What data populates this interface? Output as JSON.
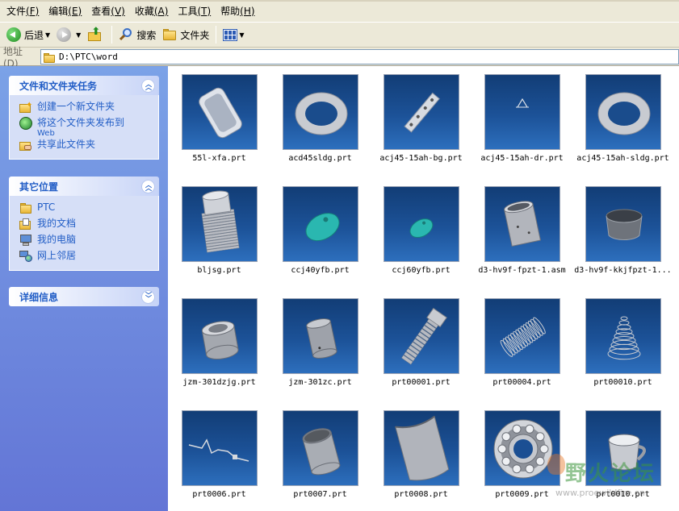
{
  "menu": {
    "items": [
      {
        "label": "文件",
        "key": "(F)"
      },
      {
        "label": "编辑",
        "key": "(E)"
      },
      {
        "label": "查看",
        "key": "(V)"
      },
      {
        "label": "收藏",
        "key": "(A)"
      },
      {
        "label": "工具",
        "key": "(T)"
      },
      {
        "label": "帮助",
        "key": "(H)"
      }
    ]
  },
  "toolbar": {
    "back_label": "后退",
    "search_label": "搜索",
    "folders_label": "文件夹",
    "icons": [
      "back-arrow-icon",
      "forward-arrow-icon",
      "up-folder-icon",
      "search-icon",
      "folder-icon",
      "views-icon"
    ]
  },
  "address": {
    "label": "地址",
    "key": "(D)",
    "path": "D:\\PTC\\word"
  },
  "taskpane": {
    "file_tasks": {
      "title": "文件和文件夹任务",
      "items": [
        {
          "label": "创建一个新文件夹",
          "sub": ""
        },
        {
          "label": "将这个文件夹发布到",
          "sub": "Web"
        },
        {
          "label": "共享此文件夹",
          "sub": ""
        }
      ]
    },
    "other_places": {
      "title": "其它位置",
      "items": [
        {
          "label": "PTC"
        },
        {
          "label": "我的文档"
        },
        {
          "label": "我的电脑"
        },
        {
          "label": "网上邻居"
        }
      ]
    },
    "details": {
      "title": "详细信息"
    }
  },
  "files": [
    {
      "name": "55l-xfa.prt",
      "shape": "tub"
    },
    {
      "name": "acd45sldg.prt",
      "shape": "ring"
    },
    {
      "name": "acj45-15ah-bg.prt",
      "shape": "plate"
    },
    {
      "name": "acj45-15ah-dr.prt",
      "shape": "triangle"
    },
    {
      "name": "acj45-15ah-sldg.prt",
      "shape": "ring"
    },
    {
      "name": "bljsg.prt",
      "shape": "threaded-cylinder"
    },
    {
      "name": "ccj40yfb.prt",
      "shape": "oval-cyan"
    },
    {
      "name": "ccj60yfb.prt",
      "shape": "oval-cyan-small"
    },
    {
      "name": "d3-hv9f-fpzt-1.asm",
      "shape": "cylinder"
    },
    {
      "name": "d3-hv9f-kkjfpzt-1...",
      "shape": "band"
    },
    {
      "name": "jzm-301dzjg.prt",
      "shape": "hollow-cylinder"
    },
    {
      "name": "jzm-301zc.prt",
      "shape": "cylinder-small"
    },
    {
      "name": "prt00001.prt",
      "shape": "bolt"
    },
    {
      "name": "prt00004.prt",
      "shape": "spring"
    },
    {
      "name": "prt00010.prt",
      "shape": "cone-spring"
    },
    {
      "name": "prt0006.prt",
      "shape": "wire"
    },
    {
      "name": "prt0007.prt",
      "shape": "tube"
    },
    {
      "name": "prt0008.prt",
      "shape": "half-tube"
    },
    {
      "name": "prt0009.prt",
      "shape": "bearing"
    },
    {
      "name": "prt0010.prt",
      "shape": "cup"
    }
  ],
  "watermark": {
    "text": "野火论坛",
    "url": "www.proewildfire.cn"
  }
}
